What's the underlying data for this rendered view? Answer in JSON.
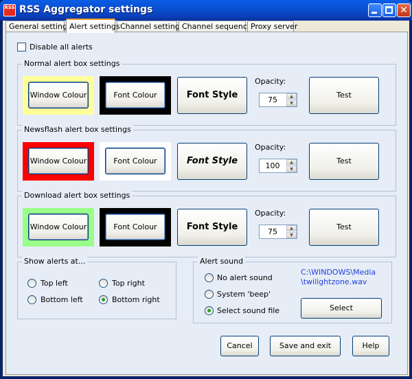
{
  "window": {
    "title": "RSS Aggregator settings",
    "icon": "rss-icon",
    "icon_text": "RSS",
    "minimize": "minimize-icon",
    "maximize": "maximize-icon",
    "close": "✕"
  },
  "tabs": [
    "General settings",
    "Alert settings",
    "Channel settings",
    "Channel sequence",
    "Proxy server"
  ],
  "active_tab": "Alert settings",
  "disable_all_alerts": {
    "label": "Disable all alerts",
    "checked": false
  },
  "groups": {
    "normal": {
      "title": "Normal alert box settings",
      "window_colour_label": "Window Colour",
      "window_colour": "#ffff99",
      "font_colour_label": "Font Colour",
      "font_colour": "#000000",
      "font_style_label": "Font Style",
      "opacity_label": "Opacity:",
      "opacity": "75",
      "test_label": "Test"
    },
    "newsflash": {
      "title": "Newsflash alert box settings",
      "window_colour_label": "Window Colour",
      "window_colour": "#ff0000",
      "font_colour_label": "Font Colour",
      "font_colour": "#ffffff",
      "font_style_label": "Font Style",
      "opacity_label": "Opacity:",
      "opacity": "100",
      "test_label": "Test"
    },
    "download": {
      "title": "Download alert box settings",
      "window_colour_label": "Window Colour",
      "window_colour": "#99ff88",
      "font_colour_label": "Font Colour",
      "font_colour": "#000000",
      "font_style_label": "Font Style",
      "opacity_label": "Opacity:",
      "opacity": "75",
      "test_label": "Test"
    }
  },
  "show_alerts": {
    "title": "Show alerts at...",
    "options": [
      "Top left",
      "Top right",
      "Bottom left",
      "Bottom right"
    ],
    "selected": "Bottom right"
  },
  "alert_sound": {
    "title": "Alert sound",
    "options": [
      "No alert sound",
      "System 'beep'",
      "Select sound file"
    ],
    "selected": "Select sound file",
    "path_line1": "C:\\WINDOWS\\Media",
    "path_line2": "\\twilightzone.wav",
    "select_label": "Select"
  },
  "buttons": {
    "cancel": "Cancel",
    "save": "Save and exit",
    "help": "Help"
  }
}
